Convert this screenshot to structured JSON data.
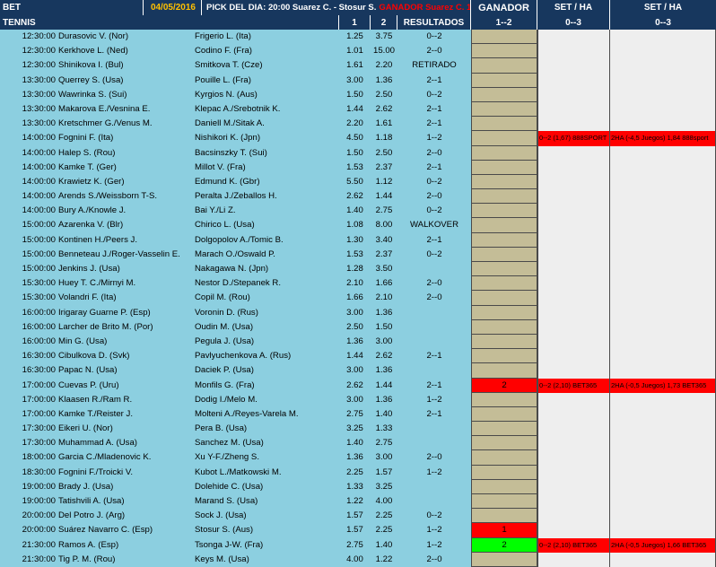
{
  "header": {
    "bet": "BET",
    "date": "04/05/2016",
    "pick_label": "PICK DEL DIA:",
    "pick_match": "20:00 Suarez C. - Stosur S.",
    "pick_result": "GANADOR Suarez C. 1,57",
    "ganador": "GANADOR",
    "set_ha_1": "SET / HA",
    "set_ha_2": "SET / HA",
    "tennis": "TENNIS",
    "col_1": "1",
    "col_2": "2",
    "resultados": "RESULTADOS",
    "ganador_range": "1--2",
    "set_range_1": "0--3",
    "set_range_2": "0--3"
  },
  "colors": {
    "header_bg": "#17375e",
    "left_bg": "#8ccfe0",
    "ganador_bg": "#c4bd97",
    "set_bg": "#eeeeee",
    "highlight_red": "#ff0000",
    "highlight_green": "#00ff00",
    "date_color": "#ffc000"
  },
  "rows": [
    {
      "time": "12:30:00",
      "p1": "Durasovic V. (Nor)",
      "p2": "Frigerio L. (Ita)",
      "o1": "1.25",
      "o2": "3.75",
      "res": "0--2",
      "gan": "",
      "set1": "",
      "set2": "",
      "hl": ""
    },
    {
      "time": "12:30:00",
      "p1": "Kerkhove L. (Ned)",
      "p2": "Codino F. (Fra)",
      "o1": "1.01",
      "o2": "15.00",
      "res": "2--0",
      "gan": "",
      "set1": "",
      "set2": "",
      "hl": ""
    },
    {
      "time": "12:30:00",
      "p1": "Shinikova I. (Bul)",
      "p2": "Smitkova T. (Cze)",
      "o1": "1.61",
      "o2": "2.20",
      "res": "RETIRADO",
      "gan": "",
      "set1": "",
      "set2": "",
      "hl": ""
    },
    {
      "time": "13:30:00",
      "p1": "Querrey S. (Usa)",
      "p2": "Pouille L. (Fra)",
      "o1": "3.00",
      "o2": "1.36",
      "res": "2--1",
      "gan": "",
      "set1": "",
      "set2": "",
      "hl": ""
    },
    {
      "time": "13:30:00",
      "p1": "Wawrinka S. (Sui)",
      "p2": "Kyrgios N. (Aus)",
      "o1": "1.50",
      "o2": "2.50",
      "res": "0--2",
      "gan": "",
      "set1": "",
      "set2": "",
      "hl": ""
    },
    {
      "time": "13:30:00",
      "p1": "Makarova E./Vesnina E.",
      "p2": "Klepac A./Srebotnik K.",
      "o1": "1.44",
      "o2": "2.62",
      "res": "2--1",
      "gan": "",
      "set1": "",
      "set2": "",
      "hl": ""
    },
    {
      "time": "13:30:00",
      "p1": "Kretschmer G./Venus M.",
      "p2": "Daniell M./Sitak A.",
      "o1": "2.20",
      "o2": "1.61",
      "res": "2--1",
      "gan": "",
      "set1": "",
      "set2": "",
      "hl": ""
    },
    {
      "time": "14:00:00",
      "p1": "Fognini F. (Ita)",
      "p2": "Nishikori K. (Jpn)",
      "o1": "4.50",
      "o2": "1.18",
      "res": "1--2",
      "gan": "",
      "set1": "0--2 (1,67) 888SPORT",
      "set2": "2HA (-4,5 Juegos) 1,84 888sport",
      "hl": "set"
    },
    {
      "time": "14:00:00",
      "p1": "Halep S. (Rou)",
      "p2": "Bacsinszky T. (Sui)",
      "o1": "1.50",
      "o2": "2.50",
      "res": "2--0",
      "gan": "",
      "set1": "",
      "set2": "",
      "hl": ""
    },
    {
      "time": "14:00:00",
      "p1": "Kamke T. (Ger)",
      "p2": "Millot V. (Fra)",
      "o1": "1.53",
      "o2": "2.37",
      "res": "2--1",
      "gan": "",
      "set1": "",
      "set2": "",
      "hl": ""
    },
    {
      "time": "14:00:00",
      "p1": "Krawietz K. (Ger)",
      "p2": "Edmund K. (Gbr)",
      "o1": "5.50",
      "o2": "1.12",
      "res": "0--2",
      "gan": "",
      "set1": "",
      "set2": "",
      "hl": ""
    },
    {
      "time": "14:00:00",
      "p1": "Arends S./Weissborn T-S.",
      "p2": "Peralta J./Zeballos H.",
      "o1": "2.62",
      "o2": "1.44",
      "res": "2--0",
      "gan": "",
      "set1": "",
      "set2": "",
      "hl": ""
    },
    {
      "time": "14:00:00",
      "p1": "Bury A./Knowle J.",
      "p2": "Bai Y./Li Z.",
      "o1": "1.40",
      "o2": "2.75",
      "res": "0--2",
      "gan": "",
      "set1": "",
      "set2": "",
      "hl": ""
    },
    {
      "time": "15:00:00",
      "p1": "Azarenka V. (Blr)",
      "p2": "Chirico L. (Usa)",
      "o1": "1.08",
      "o2": "8.00",
      "res": "WALKOVER",
      "gan": "",
      "set1": "",
      "set2": "",
      "hl": ""
    },
    {
      "time": "15:00:00",
      "p1": "Kontinen H./Peers J.",
      "p2": "Dolgopolov A./Tomic B.",
      "o1": "1.30",
      "o2": "3.40",
      "res": "2--1",
      "gan": "",
      "set1": "",
      "set2": "",
      "hl": ""
    },
    {
      "time": "15:00:00",
      "p1": "Benneteau J./Roger-Vasselin E.",
      "p2": "Marach O./Oswald P.",
      "o1": "1.53",
      "o2": "2.37",
      "res": "0--2",
      "gan": "",
      "set1": "",
      "set2": "",
      "hl": ""
    },
    {
      "time": "15:00:00",
      "p1": "Jenkins J. (Usa)",
      "p2": "Nakagawa N. (Jpn)",
      "o1": "1.28",
      "o2": "3.50",
      "res": "",
      "gan": "",
      "set1": "",
      "set2": "",
      "hl": ""
    },
    {
      "time": "15:30:00",
      "p1": "Huey T. C./Mirnyi M.",
      "p2": "Nestor D./Stepanek R.",
      "o1": "2.10",
      "o2": "1.66",
      "res": "2--0",
      "gan": "",
      "set1": "",
      "set2": "",
      "hl": ""
    },
    {
      "time": "15:30:00",
      "p1": "Volandri F. (Ita)",
      "p2": "Copil M. (Rou)",
      "o1": "1.66",
      "o2": "2.10",
      "res": "2--0",
      "gan": "",
      "set1": "",
      "set2": "",
      "hl": ""
    },
    {
      "time": "16:00:00",
      "p1": "Irigaray Guarne P. (Esp)",
      "p2": "Voronin D. (Rus)",
      "o1": "3.00",
      "o2": "1.36",
      "res": "",
      "gan": "",
      "set1": "",
      "set2": "",
      "hl": ""
    },
    {
      "time": "16:00:00",
      "p1": "Larcher de Brito M. (Por)",
      "p2": "Oudin M. (Usa)",
      "o1": "2.50",
      "o2": "1.50",
      "res": "",
      "gan": "",
      "set1": "",
      "set2": "",
      "hl": ""
    },
    {
      "time": "16:00:00",
      "p1": "Min G. (Usa)",
      "p2": "Pegula J. (Usa)",
      "o1": "1.36",
      "o2": "3.00",
      "res": "",
      "gan": "",
      "set1": "",
      "set2": "",
      "hl": ""
    },
    {
      "time": "16:30:00",
      "p1": "Cibulkova D. (Svk)",
      "p2": "Pavlyuchenkova A. (Rus)",
      "o1": "1.44",
      "o2": "2.62",
      "res": "2--1",
      "gan": "",
      "set1": "",
      "set2": "",
      "hl": ""
    },
    {
      "time": "16:30:00",
      "p1": "Papac N. (Usa)",
      "p2": "Daciek P. (Usa)",
      "o1": "3.00",
      "o2": "1.36",
      "res": "",
      "gan": "",
      "set1": "",
      "set2": "",
      "hl": ""
    },
    {
      "time": "17:00:00",
      "p1": "Cuevas P. (Uru)",
      "p2": "Monfils G. (Fra)",
      "o1": "2.62",
      "o2": "1.44",
      "res": "2--1",
      "gan": "2",
      "set1": "0--2 (2,10) BET365",
      "set2": "2HA (-0,5 Juegos) 1,73 BET365",
      "hl": "red"
    },
    {
      "time": "17:00:00",
      "p1": "Klaasen R./Ram R.",
      "p2": "Dodig I./Melo M.",
      "o1": "3.00",
      "o2": "1.36",
      "res": "1--2",
      "gan": "",
      "set1": "",
      "set2": "",
      "hl": ""
    },
    {
      "time": "17:00:00",
      "p1": "Kamke T./Reister J.",
      "p2": "Molteni A./Reyes-Varela M.",
      "o1": "2.75",
      "o2": "1.40",
      "res": "2--1",
      "gan": "",
      "set1": "",
      "set2": "",
      "hl": ""
    },
    {
      "time": "17:30:00",
      "p1": "Eikeri U. (Nor)",
      "p2": "Pera B. (Usa)",
      "o1": "3.25",
      "o2": "1.33",
      "res": "",
      "gan": "",
      "set1": "",
      "set2": "",
      "hl": ""
    },
    {
      "time": "17:30:00",
      "p1": "Muhammad A. (Usa)",
      "p2": "Sanchez M. (Usa)",
      "o1": "1.40",
      "o2": "2.75",
      "res": "",
      "gan": "",
      "set1": "",
      "set2": "",
      "hl": ""
    },
    {
      "time": "18:00:00",
      "p1": "Garcia C./Mladenovic K.",
      "p2": "Xu Y-F./Zheng S.",
      "o1": "1.36",
      "o2": "3.00",
      "res": "2--0",
      "gan": "",
      "set1": "",
      "set2": "",
      "hl": ""
    },
    {
      "time": "18:30:00",
      "p1": "Fognini F./Troicki V.",
      "p2": "Kubot L./Matkowski M.",
      "o1": "2.25",
      "o2": "1.57",
      "res": "1--2",
      "gan": "",
      "set1": "",
      "set2": "",
      "hl": ""
    },
    {
      "time": "19:00:00",
      "p1": "Brady J. (Usa)",
      "p2": "Dolehide C. (Usa)",
      "o1": "1.33",
      "o2": "3.25",
      "res": "",
      "gan": "",
      "set1": "",
      "set2": "",
      "hl": ""
    },
    {
      "time": "19:00:00",
      "p1": "Tatishvili A. (Usa)",
      "p2": "Marand S. (Usa)",
      "o1": "1.22",
      "o2": "4.00",
      "res": "",
      "gan": "",
      "set1": "",
      "set2": "",
      "hl": ""
    },
    {
      "time": "20:00:00",
      "p1": "Del Potro J. (Arg)",
      "p2": "Sock J. (Usa)",
      "o1": "1.57",
      "o2": "2.25",
      "res": "0--2",
      "gan": "",
      "set1": "",
      "set2": "",
      "hl": ""
    },
    {
      "time": "20:00:00",
      "p1": "Suárez Navarro C. (Esp)",
      "p2": "Stosur S. (Aus)",
      "o1": "1.57",
      "o2": "2.25",
      "res": "1--2",
      "gan": "1",
      "set1": "",
      "set2": "",
      "hl": "gan-red"
    },
    {
      "time": "21:30:00",
      "p1": "Ramos A. (Esp)",
      "p2": "Tsonga J-W. (Fra)",
      "o1": "2.75",
      "o2": "1.40",
      "res": "1--2",
      "gan": "2",
      "set1": "0--2 (2,10) BET365",
      "set2": "2HA (-0,5 Juegos) 1,66 BET365",
      "hl": "green"
    },
    {
      "time": "21:30:00",
      "p1": "Tig P. M. (Rou)",
      "p2": "Keys M. (Usa)",
      "o1": "4.00",
      "o2": "1.22",
      "res": "2--0",
      "gan": "",
      "set1": "",
      "set2": "",
      "hl": ""
    }
  ]
}
